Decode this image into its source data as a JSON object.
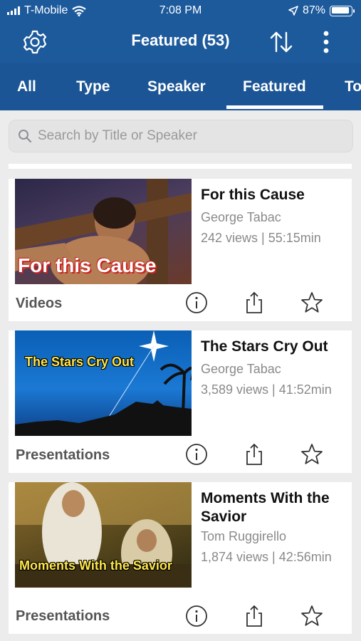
{
  "status_bar": {
    "carrier": "T-Mobile",
    "time": "7:08 PM",
    "battery": "87%"
  },
  "header": {
    "title": "Featured (53)"
  },
  "tabs": [
    {
      "label": "All"
    },
    {
      "label": "Type"
    },
    {
      "label": "Speaker"
    },
    {
      "label": "Featured",
      "selected": true
    },
    {
      "label": "To"
    }
  ],
  "search": {
    "placeholder": "Search by Title or Speaker"
  },
  "items": [
    {
      "title": "For this Cause",
      "speaker": "George Tabac",
      "meta": "242 views | 55:15min",
      "type": "Videos",
      "thumb_caption": "For this Cause"
    },
    {
      "title": "The Stars Cry Out",
      "speaker": "George Tabac",
      "meta": "3,589 views | 41:52min",
      "type": "Presentations",
      "thumb_caption": "The Stars Cry Out"
    },
    {
      "title": "Moments With the Savior",
      "speaker": "Tom Ruggirello",
      "meta": "1,874 views | 42:56min",
      "type": "Presentations",
      "thumb_caption": "Moments With the Savior"
    }
  ],
  "colors": {
    "brand_blue": "#1d5a9c",
    "background": "#ececec"
  },
  "icons": [
    "settings-gear-icon",
    "sort-icon",
    "more-vertical-icon",
    "search-icon",
    "info-icon",
    "share-icon",
    "star-icon"
  ]
}
